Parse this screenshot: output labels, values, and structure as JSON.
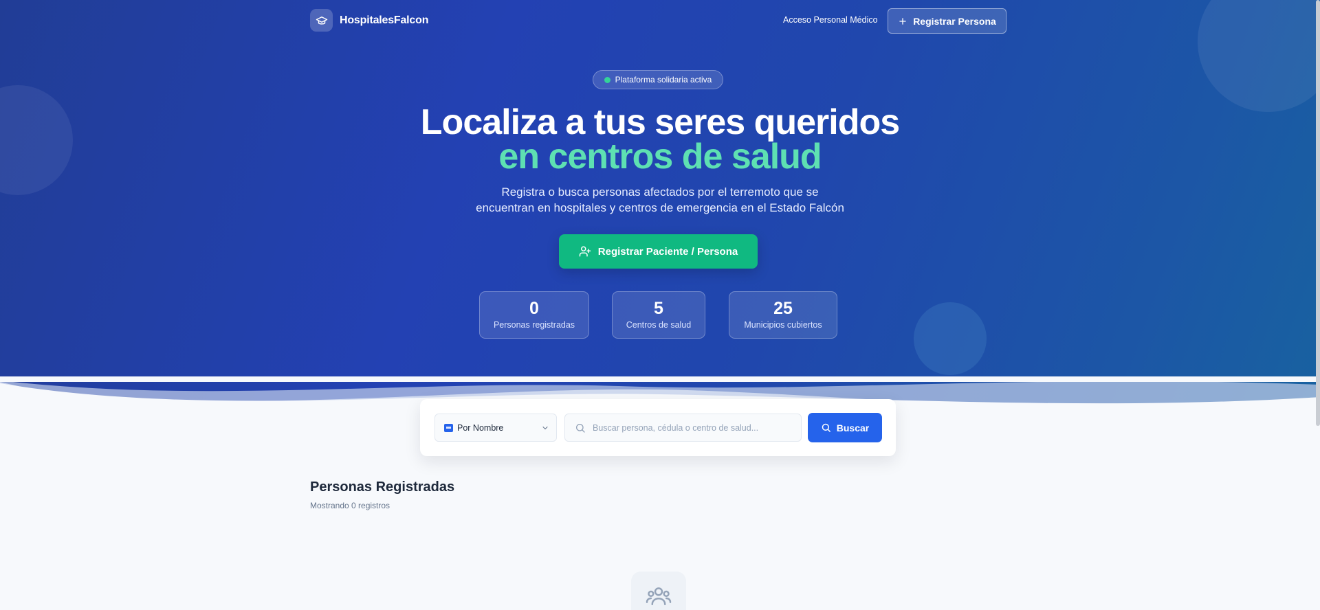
{
  "brand": {
    "name": "HospitalesFalcon"
  },
  "nav": {
    "medical_access": "Acceso Personal Médico",
    "register_button": "Registrar Persona"
  },
  "hero": {
    "badge": "Plataforma solidaria activa",
    "title_line1": "Localiza a tus seres queridos",
    "title_line2": "en centros de salud",
    "subtitle_line1": "Registra o busca personas afectados por el terremoto que se",
    "subtitle_line2": "encuentran en hospitales y centros de emergencia en el Estado Falcón",
    "cta": "Registrar Paciente / Persona"
  },
  "stats": [
    {
      "value": "0",
      "label": "Personas registradas"
    },
    {
      "value": "5",
      "label": "Centros de salud"
    },
    {
      "value": "25",
      "label": "Municipios cubiertos"
    }
  ],
  "search": {
    "mode": "Por Nombre",
    "placeholder": "Buscar persona, cédula o centro de salud...",
    "button": "Buscar"
  },
  "results": {
    "title": "Personas Registradas",
    "count_text": "Mostrando 0 registros"
  },
  "colors": {
    "hero_blue": "#2341b3",
    "accent_green": "#10b981",
    "title_green": "#5ee0b2",
    "primary_blue": "#2563eb"
  },
  "icons": {
    "logo": "graduation-cap-icon",
    "register": "plus-icon",
    "cta": "user-plus-icon",
    "search": "search-icon",
    "empty": "users-icon"
  }
}
